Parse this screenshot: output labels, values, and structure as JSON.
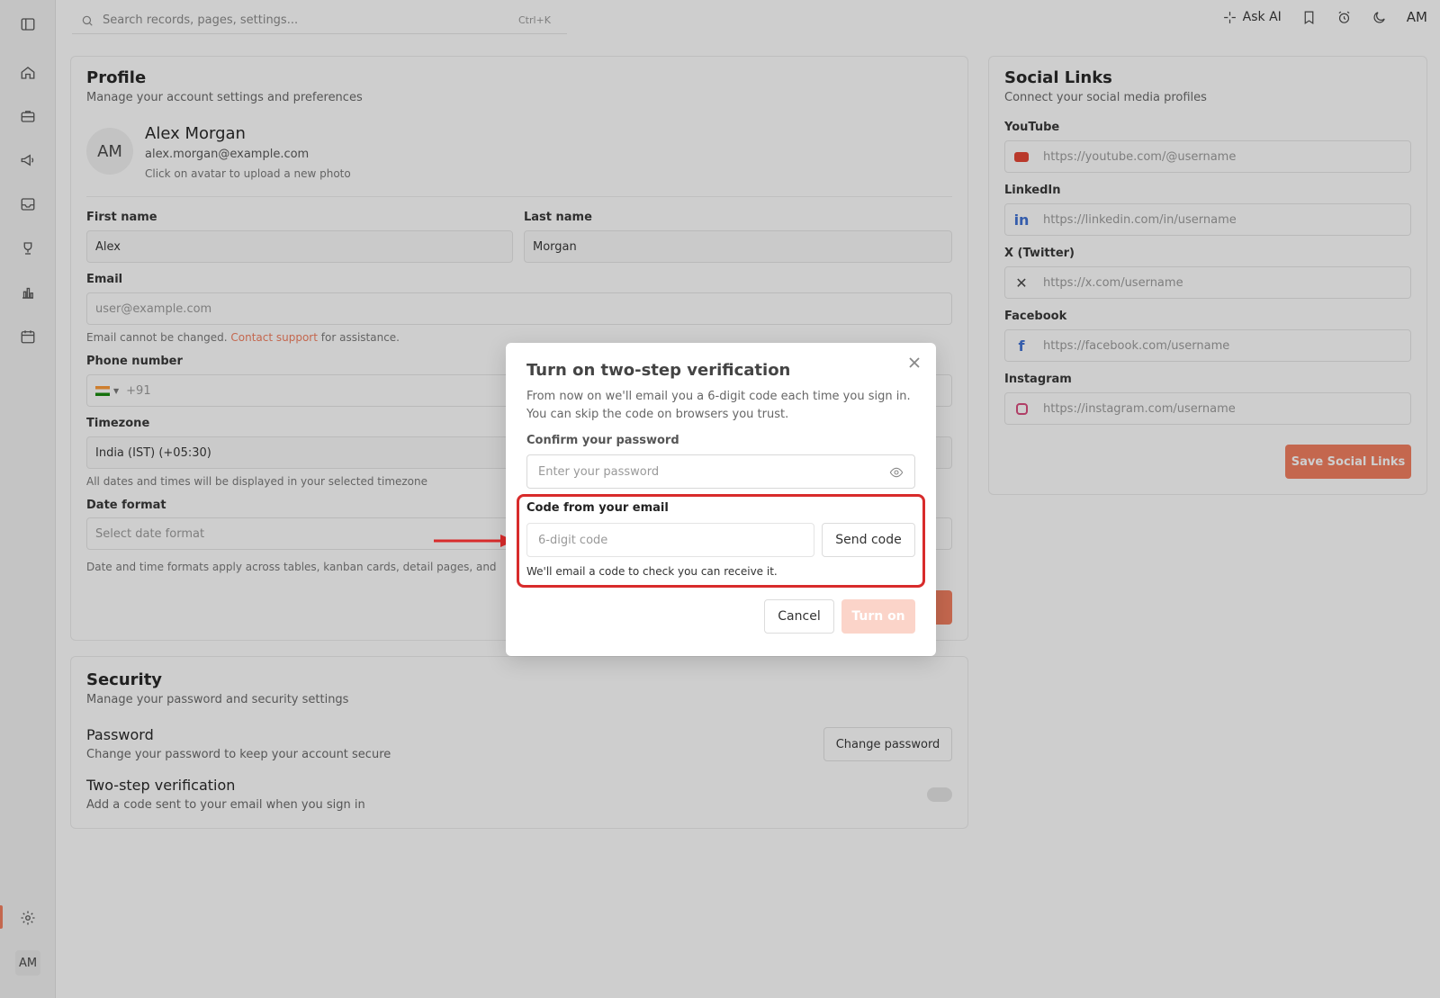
{
  "search": {
    "placeholder": "Search records, pages, settings...",
    "shortcut": "Ctrl+K"
  },
  "topbar": {
    "ask_ai": "Ask AI",
    "user_initials": "AM"
  },
  "sidebar": {
    "user_initials": "AM"
  },
  "profile": {
    "title": "Profile",
    "subtitle": "Manage your account settings and preferences",
    "avatar_initials": "AM",
    "name": "Alex Morgan",
    "email": "alex.morgan@example.com",
    "avatar_hint": "Click on avatar to upload a new photo",
    "first_name_label": "First name",
    "first_name_value": "Alex",
    "last_name_label": "Last name",
    "last_name_value": "Morgan",
    "email_label": "Email",
    "email_placeholder": "user@example.com",
    "email_note_prefix": "Email cannot be changed.",
    "email_note_link": "Contact support",
    "email_note_suffix": "for assistance.",
    "phone_label": "Phone number",
    "phone_code": "+91",
    "timezone_label": "Timezone",
    "timezone_value": "India (IST) (+05:30)",
    "timezone_note": "All dates and times will be displayed in your selected timezone",
    "date_format_label": "Date format",
    "date_format_placeholder": "Select date format",
    "date_note": "Date and time formats apply across tables, kanban cards, detail pages, and"
  },
  "security": {
    "title": "Security",
    "subtitle": "Manage your password and security settings",
    "password_title": "Password",
    "password_desc": "Change your password to keep your account secure",
    "change_password_btn": "Change password",
    "twostep_title": "Two-step verification",
    "twostep_desc": "Add a code sent to your email when you sign in"
  },
  "social": {
    "title": "Social Links",
    "subtitle": "Connect your social media profiles",
    "youtube_label": "YouTube",
    "youtube_placeholder": "https://youtube.com/@username",
    "linkedin_label": "LinkedIn",
    "linkedin_placeholder": "https://linkedin.com/in/username",
    "x_label": "X (Twitter)",
    "x_placeholder": "https://x.com/username",
    "facebook_label": "Facebook",
    "facebook_placeholder": "https://facebook.com/username",
    "instagram_label": "Instagram",
    "instagram_placeholder": "https://instagram.com/username",
    "save_btn": "Save Social Links"
  },
  "modal": {
    "title": "Turn on two-step verification",
    "description": "From now on we'll email you a 6-digit code each time you sign in. You can skip the code on browsers you trust.",
    "password_label": "Confirm your password",
    "password_placeholder": "Enter your password",
    "code_label": "Code from your email",
    "code_placeholder": "6-digit code",
    "send_code_btn": "Send code",
    "code_help": "We'll email a code to check you can receive it.",
    "cancel_btn": "Cancel",
    "turn_on_btn": "Turn on"
  }
}
